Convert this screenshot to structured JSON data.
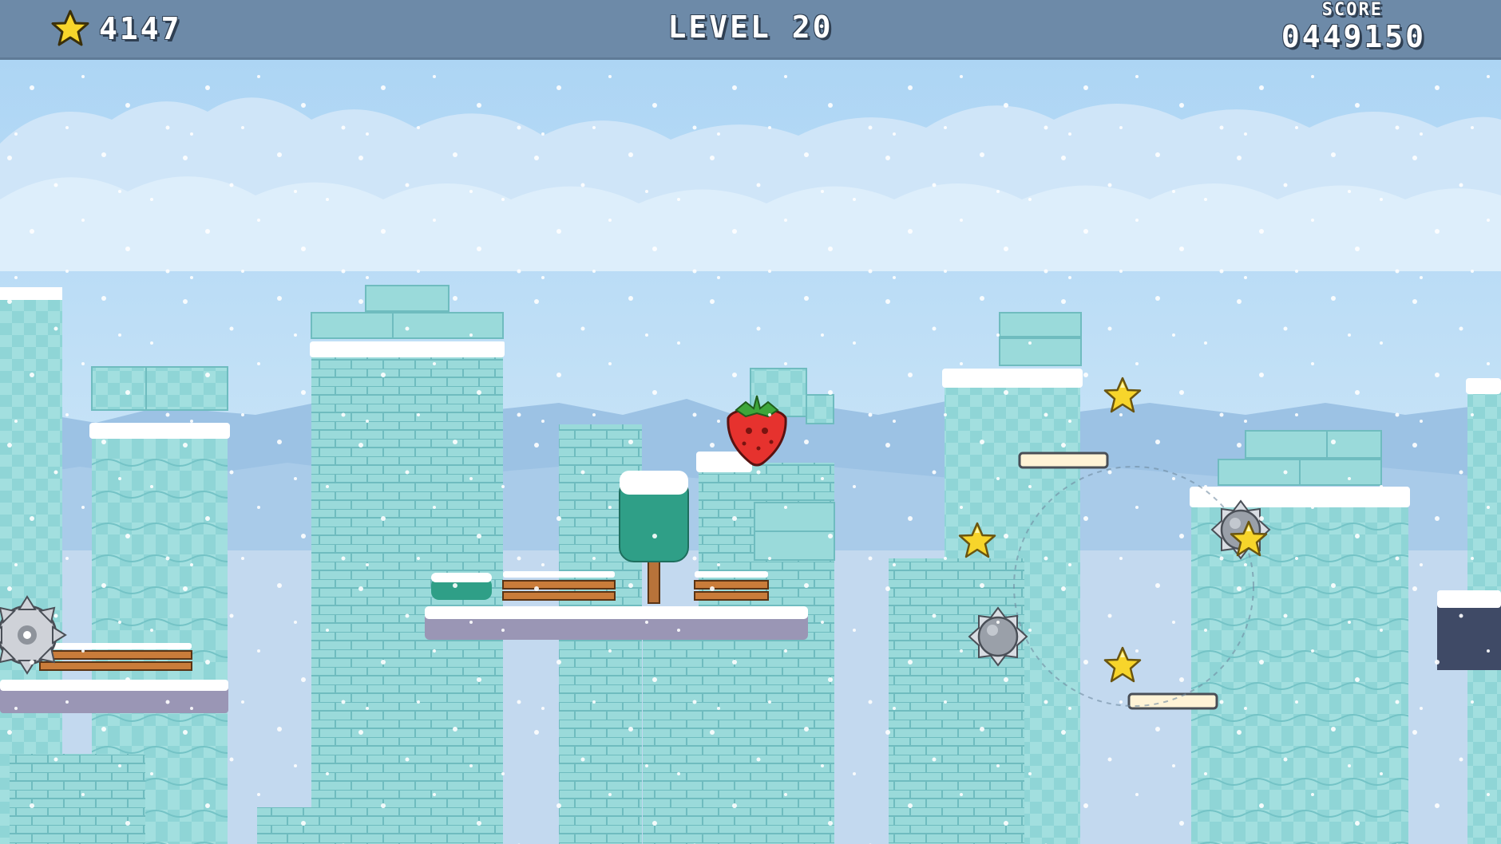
{
  "hud": {
    "star_count": "4147",
    "level": "LEVEL 20",
    "score_label": "SCORE",
    "score_value": "0449150",
    "star_icon": "star-icon"
  },
  "colors": {
    "hud_bar": "#6d8aa8",
    "sky": "#b9dcf5",
    "ice": "#8fd6d6",
    "snow": "#ffffff",
    "star": "#f5d22a",
    "strawberry": "#e6322e"
  }
}
